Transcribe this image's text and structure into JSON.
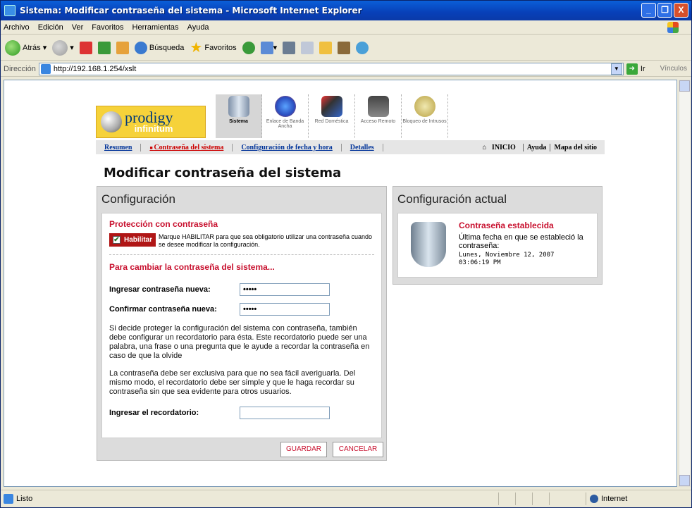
{
  "window": {
    "title": "Sistema: Modificar contraseña del sistema - Microsoft Internet Explorer",
    "min": "_",
    "max": "❐",
    "close": "X"
  },
  "menu": [
    "Archivo",
    "Edición",
    "Ver",
    "Favoritos",
    "Herramientas",
    "Ayuda"
  ],
  "toolbar": {
    "back": "Atrás",
    "search": "Búsqueda",
    "favorites": "Favoritos"
  },
  "address": {
    "label": "Dirección",
    "url": "http://192.168.1.254/xslt",
    "go": "Ir",
    "links": "Vínculos"
  },
  "status": {
    "text": "Listo",
    "zone": "Internet"
  },
  "logo": {
    "main": "prodigy",
    "sub": "infinitum"
  },
  "nav": [
    {
      "label": "Sistema",
      "active": true
    },
    {
      "label": "Enlace de Banda Ancha",
      "active": false
    },
    {
      "label": "Red Doméstica",
      "active": false
    },
    {
      "label": "Acceso Remoto",
      "active": false
    },
    {
      "label": "Bloqueo de Intrusos",
      "active": false
    }
  ],
  "subnav": {
    "links": [
      "Resumen",
      "Contraseña del sistema",
      "Configuración de fecha y hora",
      "Detalles"
    ],
    "right": [
      "INICIO",
      "Ayuda",
      "Mapa del sitio"
    ]
  },
  "page": {
    "title": "Modificar contraseña del sistema"
  },
  "config": {
    "title": "Configuración",
    "protection_heading": "Protección con contraseña",
    "enable_label": "Habilitar",
    "enable_checked": true,
    "enable_help": "Marque HABILITAR para que sea obligatorio utilizar una contraseña cuando se desee modificar la configuración.",
    "change_heading": "Para cambiar la contraseña del sistema...",
    "new_pw_label": "Ingresar contraseña nueva:",
    "new_pw_value": "•••••",
    "confirm_pw_label": "Confirmar contraseña nueva:",
    "confirm_pw_value": "•••••",
    "para1": "Si decide proteger la configuración del sistema con contraseña, también debe configurar un recordatorio para ésta. Este recordatorio puede ser una palabra, una frase o una pregunta que le ayude a recordar la contraseña en caso de que la olvide",
    "para2": "La contraseña debe ser exclusiva para que no sea fácil averiguarla. Del mismo modo, el recordatorio debe ser simple y que le haga recordar su contraseña sin que sea evidente para otros usuarios.",
    "reminder_label": "Ingresar el recordatorio:",
    "reminder_value": "",
    "save": "GUARDAR",
    "cancel": "CANCELAR"
  },
  "current": {
    "title": "Configuración actual",
    "status_heading": "Contraseña establecida",
    "last_label": "Última fecha en que se estableció la contraseña:",
    "date": "Lunes, Noviembre 12, 2007",
    "time": "03:06:19 PM"
  },
  "colors": {
    "accent_red": "#c8102e",
    "link_blue": "#003399",
    "xp_title": "#0840b8"
  }
}
